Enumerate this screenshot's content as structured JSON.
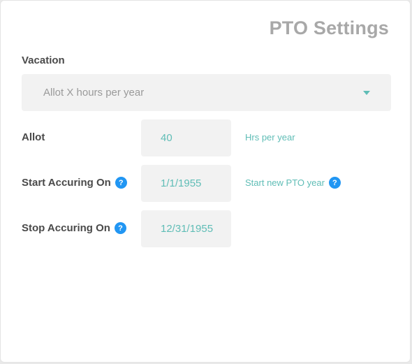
{
  "header": {
    "title": "PTO Settings"
  },
  "vacation": {
    "label": "Vacation",
    "policy_select": {
      "value": "Allot X hours per year"
    }
  },
  "allot": {
    "label": "Allot",
    "value": "40",
    "unit_hint": "Hrs per year"
  },
  "start_accruing": {
    "label": "Start Accuring On",
    "value": "1/1/1955",
    "hint": "Start new PTO year"
  },
  "stop_accruing": {
    "label": "Stop Accuring On",
    "value": "12/31/1955"
  },
  "help_icon_glyph": "?",
  "colors": {
    "accent_teal": "#5fbdb6",
    "help_blue": "#2196f3",
    "title_gray": "#a8a8a8",
    "field_bg": "#f2f2f2"
  },
  "icons": [
    "chevron-down-icon",
    "help-icon"
  ]
}
